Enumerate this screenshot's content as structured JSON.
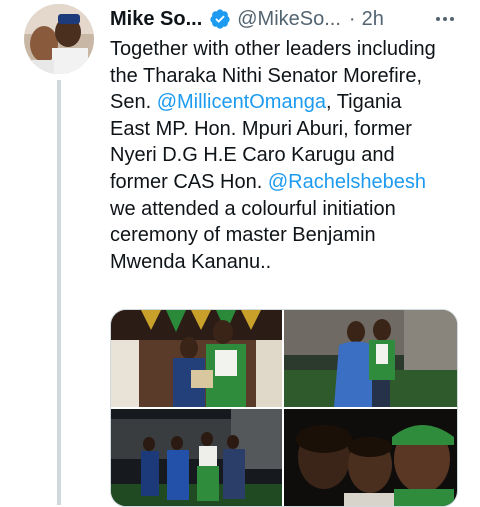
{
  "tweet": {
    "author": {
      "display_name": "Mike So...",
      "handle": "@MikeSo...",
      "verified": true,
      "avatar_icon": "profile-photo"
    },
    "separator": "·",
    "time": "2h",
    "more_icon": "ellipsis-icon",
    "text": {
      "line1": "Together with other leaders including",
      "line2": "the Tharaka Nithi Senator Morefire,",
      "line3_before": "Sen. ",
      "mention1": "@MillicentOmanga",
      "line3_after": ", Tigania",
      "line4": "East MP. Hon. Mpuri Aburi, former",
      "line5": "Nyeri D.G H.E Caro Karugu and",
      "line6_before": "former CAS Hon. ",
      "mention2": "@Rachelshebesh",
      "line7": "we attended a colourful initiation",
      "line8": "ceremony of master Benjamin",
      "line9": "Mwenda Kananu.."
    },
    "media": [
      {
        "name": "photo-ceremony-stage"
      },
      {
        "name": "photo-garden-pair"
      },
      {
        "name": "photo-night-group"
      },
      {
        "name": "photo-selfie"
      }
    ],
    "colors": {
      "link": "#1d9bf0",
      "verified_badge": "#1d9bf0",
      "secondary_text": "#536471",
      "thread_line": "#cfd9de"
    }
  }
}
